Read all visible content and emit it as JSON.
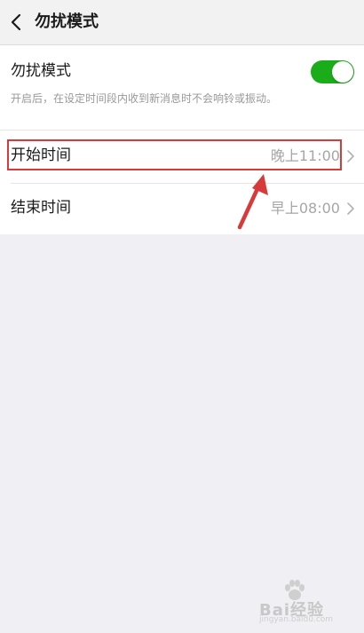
{
  "header": {
    "title": "勿扰模式",
    "back_icon": "back-arrow-icon"
  },
  "dnd": {
    "label": "勿扰模式",
    "description": "开启后，在设定时间段内收到新消息时不会响铃或振动。",
    "enabled": true,
    "toggle_color": "#1aad19"
  },
  "rows": [
    {
      "label": "开始时间",
      "value": "晚上11:00"
    },
    {
      "label": "结束时间",
      "value": "早上08:00"
    }
  ],
  "annotation": {
    "highlight_color": "#d83a3a"
  },
  "watermark": {
    "text": "Bai经验",
    "sub": "jingyan.baidu.com"
  }
}
